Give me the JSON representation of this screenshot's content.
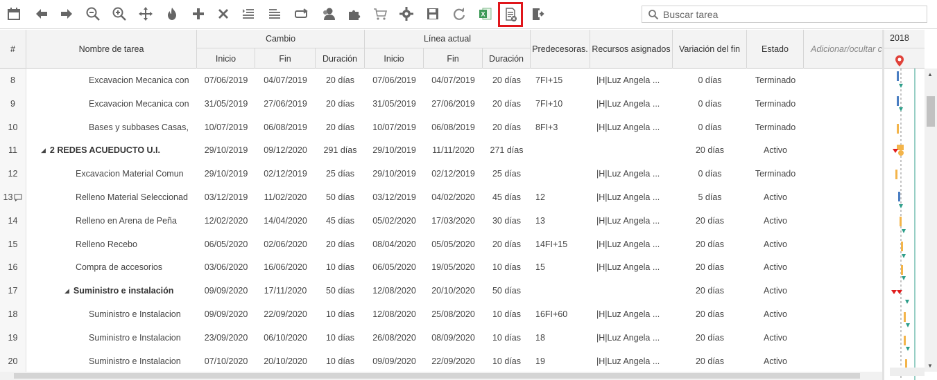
{
  "toolbar": {
    "icons": [
      "calendar-icon",
      "arrow-left-icon",
      "arrow-right-icon",
      "zoom-out-icon",
      "zoom-in-icon",
      "move-icon",
      "fire-icon",
      "add-icon",
      "delete-icon",
      "indent-icon",
      "outdent-icon",
      "link-icon",
      "user-icon",
      "puzzle-icon",
      "cart-icon",
      "gear-icon",
      "save-icon",
      "refresh-icon",
      "excel-icon",
      "document-x-icon",
      "exit-icon"
    ],
    "search_placeholder": "Buscar tarea"
  },
  "columns": {
    "num": "#",
    "name": "Nombre de tarea",
    "cambio": "Cambio",
    "linea": "Línea actual",
    "inicio": "Inicio",
    "fin": "Fin",
    "duracion": "Duración",
    "pred": "Predecesoras.",
    "recursos": "Recursos asignados",
    "variacion": "Variación del fin",
    "estado": "Estado",
    "adicionar": "Adicionar/ocultar c"
  },
  "gantt": {
    "year": "2018"
  },
  "rows": [
    {
      "num": "8",
      "name": "Excavacion Mecanica con",
      "indent": 3,
      "bold": false,
      "group": false,
      "c_ini": "07/06/2019",
      "c_fin": "04/07/2019",
      "c_dur": "20 días",
      "l_ini": "07/06/2019",
      "l_fin": "04/07/2019",
      "l_dur": "20 días",
      "pred": "7FI+15",
      "rec": "|H|Luz Angela ...",
      "var": "0 días",
      "estado": "Terminado",
      "comment": false
    },
    {
      "num": "9",
      "name": "Excavacion Mecanica con",
      "indent": 3,
      "bold": false,
      "group": false,
      "c_ini": "31/05/2019",
      "c_fin": "27/06/2019",
      "c_dur": "20 días",
      "l_ini": "31/05/2019",
      "l_fin": "27/06/2019",
      "l_dur": "20 días",
      "pred": "7FI+10",
      "rec": "|H|Luz Angela ...",
      "var": "0 días",
      "estado": "Terminado",
      "comment": false
    },
    {
      "num": "10",
      "name": "Bases y subbases Casas,",
      "indent": 3,
      "bold": false,
      "group": false,
      "c_ini": "10/07/2019",
      "c_fin": "06/08/2019",
      "c_dur": "20 días",
      "l_ini": "10/07/2019",
      "l_fin": "06/08/2019",
      "l_dur": "20 días",
      "pred": "8FI+3",
      "rec": "|H|Luz Angela ...",
      "var": "0 días",
      "estado": "Terminado",
      "comment": false
    },
    {
      "num": "11",
      "name": "2 REDES ACUEDUCTO U.I.",
      "indent": 1,
      "bold": true,
      "group": true,
      "c_ini": "29/10/2019",
      "c_fin": "09/12/2020",
      "c_dur": "291 días",
      "l_ini": "29/10/2019",
      "l_fin": "11/11/2020",
      "l_dur": "271 días",
      "pred": "",
      "rec": "",
      "var": "20 días",
      "estado": "Activo",
      "comment": false
    },
    {
      "num": "12",
      "name": "Excavacion Material Comun",
      "indent": 2,
      "bold": false,
      "group": false,
      "c_ini": "29/10/2019",
      "c_fin": "02/12/2019",
      "c_dur": "25 días",
      "l_ini": "29/10/2019",
      "l_fin": "02/12/2019",
      "l_dur": "25 días",
      "pred": "",
      "rec": "|H|Luz Angela ...",
      "var": "0 días",
      "estado": "Terminado",
      "comment": false
    },
    {
      "num": "13",
      "name": "Relleno Material Seleccionad",
      "indent": 2,
      "bold": false,
      "group": false,
      "c_ini": "03/12/2019",
      "c_fin": "11/02/2020",
      "c_dur": "50 días",
      "l_ini": "03/12/2019",
      "l_fin": "04/02/2020",
      "l_dur": "45 días",
      "pred": "12",
      "rec": "|H|Luz Angela ...",
      "var": "5 días",
      "estado": "Activo",
      "comment": true
    },
    {
      "num": "14",
      "name": "Relleno en Arena de Peña",
      "indent": 2,
      "bold": false,
      "group": false,
      "c_ini": "12/02/2020",
      "c_fin": "14/04/2020",
      "c_dur": "45 días",
      "l_ini": "05/02/2020",
      "l_fin": "17/03/2020",
      "l_dur": "30 días",
      "pred": "13",
      "rec": "|H|Luz Angela ...",
      "var": "20 días",
      "estado": "Activo",
      "comment": false
    },
    {
      "num": "15",
      "name": "Relleno Recebo",
      "indent": 2,
      "bold": false,
      "group": false,
      "c_ini": "06/05/2020",
      "c_fin": "02/06/2020",
      "c_dur": "20 días",
      "l_ini": "08/04/2020",
      "l_fin": "05/05/2020",
      "l_dur": "20 días",
      "pred": "14FI+15",
      "rec": "|H|Luz Angela ...",
      "var": "20 días",
      "estado": "Activo",
      "comment": false
    },
    {
      "num": "16",
      "name": "Compra de accesorios",
      "indent": 2,
      "bold": false,
      "group": false,
      "c_ini": "03/06/2020",
      "c_fin": "16/06/2020",
      "c_dur": "10 días",
      "l_ini": "06/05/2020",
      "l_fin": "19/05/2020",
      "l_dur": "10 días",
      "pred": "15",
      "rec": "|H|Luz Angela ...",
      "var": "20 días",
      "estado": "Activo",
      "comment": false
    },
    {
      "num": "17",
      "name": "Suministro e instalación",
      "indent": 2,
      "bold": true,
      "group": true,
      "c_ini": "09/09/2020",
      "c_fin": "17/11/2020",
      "c_dur": "50 días",
      "l_ini": "12/08/2020",
      "l_fin": "20/10/2020",
      "l_dur": "50 días",
      "pred": "",
      "rec": "",
      "var": "20 días",
      "estado": "Activo",
      "comment": false
    },
    {
      "num": "18",
      "name": "Suministro e Instalacion",
      "indent": 3,
      "bold": false,
      "group": false,
      "c_ini": "09/09/2020",
      "c_fin": "22/09/2020",
      "c_dur": "10 días",
      "l_ini": "12/08/2020",
      "l_fin": "25/08/2020",
      "l_dur": "10 días",
      "pred": "16FI+60",
      "rec": "|H|Luz Angela ...",
      "var": "20 días",
      "estado": "Activo",
      "comment": false
    },
    {
      "num": "19",
      "name": "Suministro e Instalacion",
      "indent": 3,
      "bold": false,
      "group": false,
      "c_ini": "23/09/2020",
      "c_fin": "06/10/2020",
      "c_dur": "10 días",
      "l_ini": "26/08/2020",
      "l_fin": "08/09/2020",
      "l_dur": "10 días",
      "pred": "18",
      "rec": "|H|Luz Angela ...",
      "var": "20 días",
      "estado": "Activo",
      "comment": false
    },
    {
      "num": "20",
      "name": "Suministro e Instalacion",
      "indent": 3,
      "bold": false,
      "group": false,
      "c_ini": "07/10/2020",
      "c_fin": "20/10/2020",
      "c_dur": "10 días",
      "l_ini": "09/09/2020",
      "l_fin": "22/09/2020",
      "l_dur": "10 días",
      "pred": "19",
      "rec": "|H|Luz Angela ...",
      "var": "20 días",
      "estado": "Activo",
      "comment": false
    }
  ]
}
